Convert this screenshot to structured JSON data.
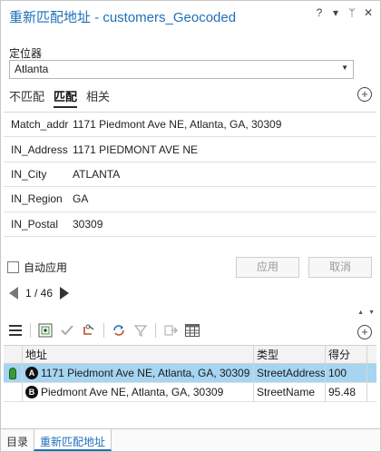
{
  "title": "重新匹配地址 - customers_Geocoded",
  "title_controls": [
    "?",
    "▾",
    "ᛘ",
    "✕"
  ],
  "locator": {
    "label": "定位器",
    "value": "Atlanta"
  },
  "tabs": [
    {
      "label": "不匹配",
      "active": false
    },
    {
      "label": "匹配",
      "active": true
    },
    {
      "label": "相关",
      "active": false
    }
  ],
  "fields": [
    {
      "name": "Match_addr",
      "value": "1171 Piedmont Ave NE, Atlanta, GA, 30309"
    },
    {
      "name": "IN_Address",
      "value": "1171 PIEDMONT AVE NE"
    },
    {
      "name": "IN_City",
      "value": "ATLANTA"
    },
    {
      "name": "IN_Region",
      "value": "GA"
    },
    {
      "name": "IN_Postal",
      "value": "30309"
    }
  ],
  "autoapply": {
    "label": "自动应用",
    "checked": false
  },
  "buttons": {
    "apply": "应用",
    "cancel": "取消"
  },
  "pager": {
    "text": "1 / 46"
  },
  "toolbar_icons": [
    "menu-icon",
    "zoom-to-candidate-icon",
    "check-icon",
    "rematch-icon",
    "refresh-icon",
    "filter-icon",
    "pick-address-icon",
    "table-icon"
  ],
  "grid": {
    "headers": {
      "address": "地址",
      "type": "类型",
      "score": "得分"
    },
    "rows": [
      {
        "badge": "A",
        "address": "1171 Piedmont Ave NE, Atlanta, GA, 30309",
        "type": "StreetAddress",
        "score": "100",
        "selected": true
      },
      {
        "badge": "B",
        "address": "Piedmont Ave NE, Atlanta, GA, 30309",
        "type": "StreetName",
        "score": "95.48",
        "selected": false
      }
    ]
  },
  "bottom_tabs": [
    {
      "label": "目录",
      "active": false
    },
    {
      "label": "重新匹配地址",
      "active": true
    }
  ],
  "colors": {
    "accent": "#1d6fb8",
    "selection": "#a6d5f2",
    "marker": "#3a9a3a"
  }
}
